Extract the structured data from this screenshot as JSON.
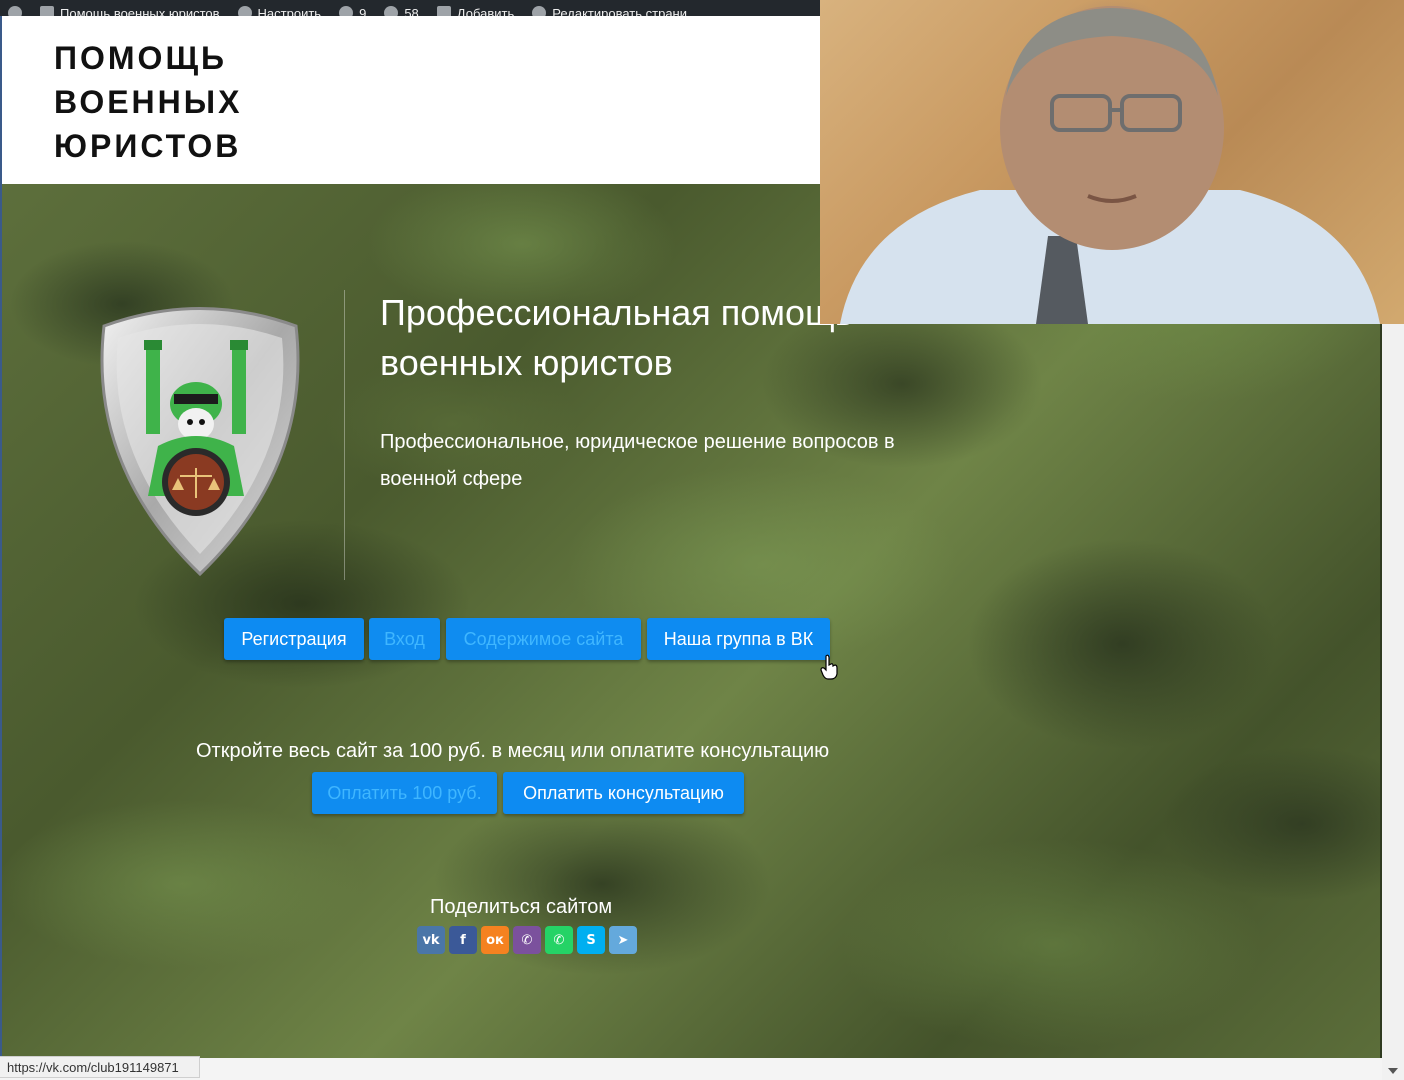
{
  "admin_bar": {
    "items": [
      {
        "label": "Помощь военных юристов",
        "icon": "home-icon"
      },
      {
        "label": "Настроить",
        "icon": "brush-icon"
      },
      {
        "label": "9",
        "icon": "updates-icon"
      },
      {
        "label": "58",
        "icon": "comments-icon"
      },
      {
        "label": "Добавить",
        "icon": "plus-icon"
      },
      {
        "label": "Редактировать страни",
        "icon": "pencil-icon"
      }
    ]
  },
  "header": {
    "site_title": "ПОМОЩЬ ВОЕННЫХ ЮРИСТОВ"
  },
  "hero": {
    "title": "Профессиональная помощь военных юристов",
    "subtitle": "Профессиональное, юридическое решение вопросов в военной сфере",
    "buttons": {
      "register": "Регистрация",
      "login": "Вход",
      "content": "Содержимое сайта",
      "vk_group": "Наша группа в ВК"
    },
    "offer_text": "Откройте весь сайт за 100 руб. в месяц или оплатите консультацию",
    "pay_buttons": {
      "pay100": "Оплатить 100 руб.",
      "consult": "Оплатить консультацию"
    },
    "share": {
      "title": "Поделиться сайтом",
      "networks": [
        {
          "name": "vk-icon",
          "glyph": "vk",
          "color": "#4a76a8"
        },
        {
          "name": "facebook-icon",
          "glyph": "f",
          "color": "#3b5998"
        },
        {
          "name": "odnoklassniki-icon",
          "glyph": "ок",
          "color": "#f58220"
        },
        {
          "name": "viber-icon",
          "glyph": "✆",
          "color": "#7b519d"
        },
        {
          "name": "whatsapp-icon",
          "glyph": "✆",
          "color": "#25d366"
        },
        {
          "name": "skype-icon",
          "glyph": "S",
          "color": "#00aff0"
        },
        {
          "name": "telegram-icon",
          "glyph": "➤",
          "color": "#64a9dc"
        }
      ]
    }
  },
  "status_bar": {
    "url": "https://vk.com/club191149871"
  }
}
